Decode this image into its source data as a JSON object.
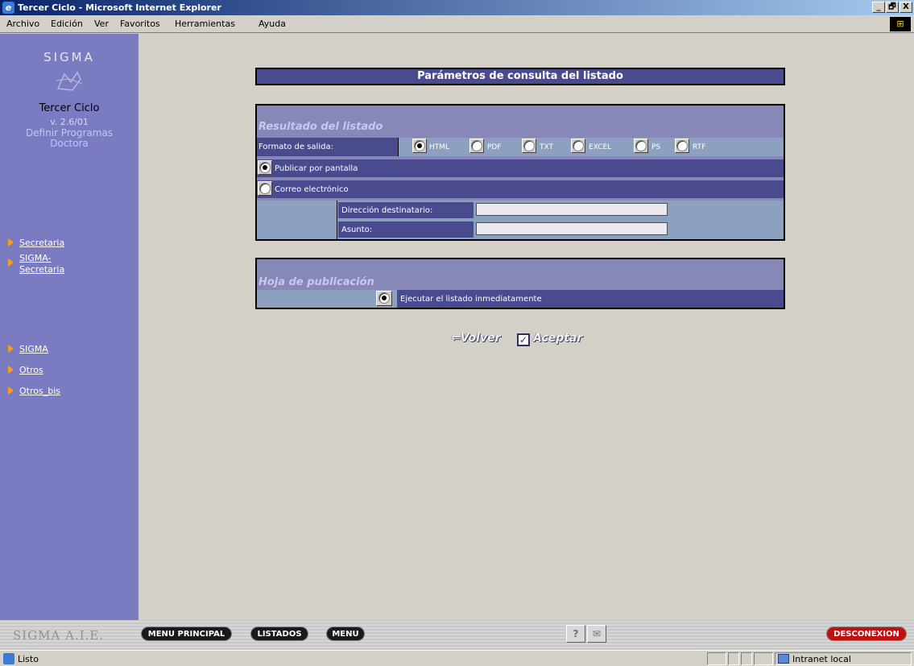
{
  "window": {
    "title": "Tercer Ciclo - Microsoft Internet Explorer",
    "controls": [
      "_",
      "🗗",
      "X"
    ]
  },
  "menubar": {
    "items": [
      "Archivo",
      "Edición",
      "Ver",
      "Favoritos",
      "Herramientas",
      "Ayuda"
    ]
  },
  "sidebar": {
    "logo_text": "SIGMA",
    "app_name": "Tercer Ciclo",
    "version": "v. 2.6/01",
    "program_line1": "Definir Programas",
    "program_line2": "Doctora",
    "nav": [
      {
        "label": "Secretaria"
      },
      {
        "label": "SIGMA-"
      },
      {
        "label": "Secretaria"
      },
      {
        "label": "SIGMA"
      },
      {
        "label": "Otros"
      },
      {
        "label": "Otros_bis"
      }
    ]
  },
  "main": {
    "title": "Parámetros de consulta del listado",
    "result_panel": {
      "title": "Resultado del listado",
      "format_label": "Formato de salida:",
      "formats": [
        {
          "label": "HTML",
          "selected": true
        },
        {
          "label": "PDF",
          "selected": false
        },
        {
          "label": "TXT",
          "selected": false
        },
        {
          "label": "EXCEL",
          "selected": false
        },
        {
          "label": "PS",
          "selected": false
        },
        {
          "label": "RTF",
          "selected": false
        }
      ],
      "publish_screen": {
        "label": "Publicar por pantalla",
        "selected": true
      },
      "email": {
        "label": "Correo electrónico",
        "selected": false
      },
      "recipient_label": "Dirección destinatario:",
      "recipient_value": "",
      "subject_label": "Asunto:",
      "subject_value": ""
    },
    "publish_panel": {
      "title": "Hoja de publicación",
      "run_now": {
        "label": "Ejecutar el listado inmediatamente",
        "selected": true
      }
    },
    "buttons": {
      "back": "Volver",
      "accept": "Aceptar"
    }
  },
  "bottombar": {
    "brand": "SIGMA A.I.E.",
    "main_menu": "MENU PRINCIPAL",
    "listings": "LISTADOS",
    "menu": "MENU",
    "help": "?",
    "mail": "✉",
    "disconnect": "DESCONEXION"
  },
  "statusbar": {
    "text": "Listo",
    "zone": "Intranet local"
  }
}
